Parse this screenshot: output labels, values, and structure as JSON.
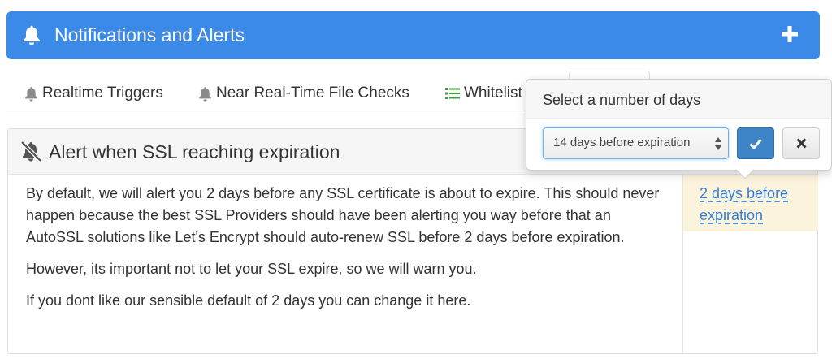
{
  "header": {
    "title": "Notifications and Alerts",
    "bg_color": "#3c8ae8",
    "icon_left": "bell-icon",
    "icon_right": "plus-icon"
  },
  "tabs": [
    {
      "label": "Realtime Triggers",
      "icon": "bell-icon"
    },
    {
      "label": "Near Real-Time File Checks",
      "icon": "bell-icon"
    },
    {
      "label": "Whitelist",
      "icon": "list-icon",
      "icon_color": "#3c9f3c"
    }
  ],
  "panel": {
    "title": "Alert when SSL reaching expiration",
    "icon": "bell-slash-icon",
    "paragraphs": [
      "By default, we will alert you 2 days before any SSL certificate is about to expire. This should never happen because the best SSL Providers should have been alerting you way before that an AutoSSL solutions like Let's Encrypt should auto-renew SSL before 2 days before expiration.",
      "However, its important not to let your SSL expire, so we will warn you.",
      "If you dont like our sensible default of 2 days you can change it here."
    ],
    "editable_value": "2 days before expiration"
  },
  "popover": {
    "title": "Select a number of days",
    "select_value": "14 days before expiration",
    "ok_icon": "check-icon",
    "cancel_icon": "close-icon"
  },
  "colors": {
    "link": "#2f7fd9",
    "highlight": "#fcf3dc",
    "ok_button": "#3d85c6"
  }
}
